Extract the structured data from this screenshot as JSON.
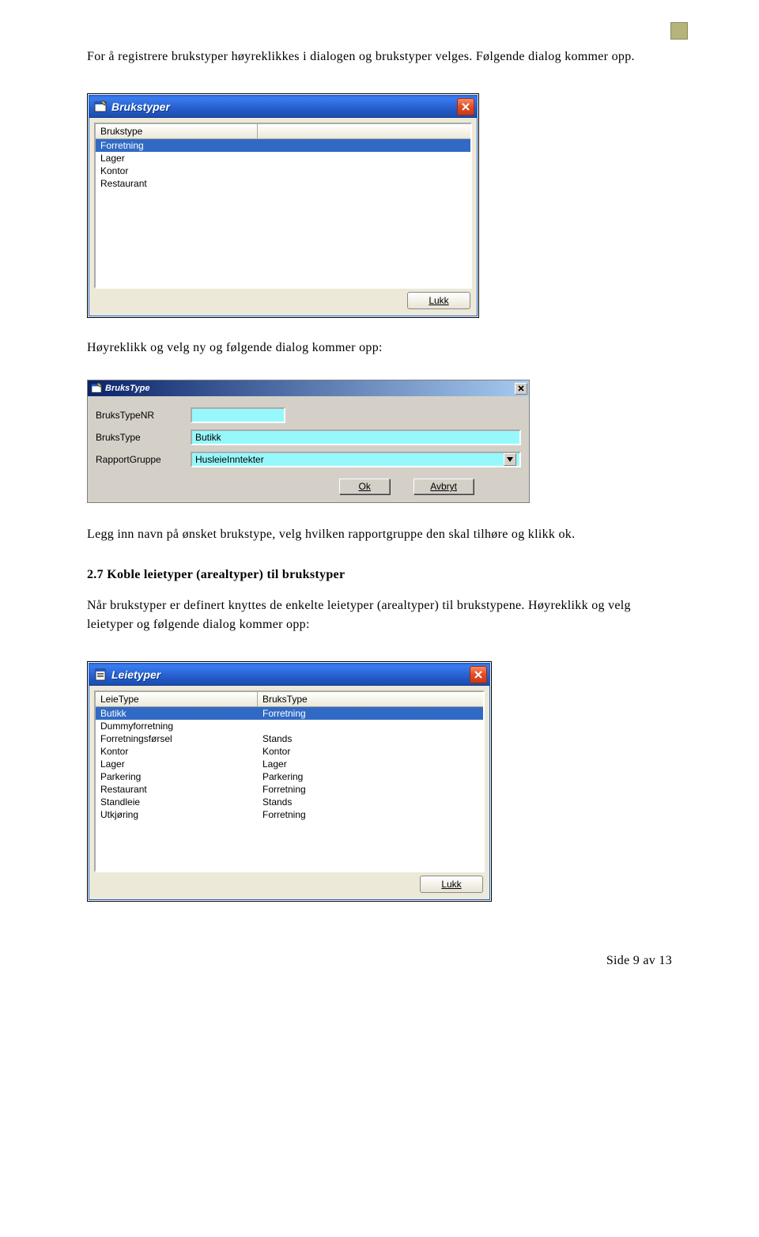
{
  "para1": "For å registrere brukstyper høyreklikkes i dialogen og brukstyper velges. Følgende dialog kommer opp.",
  "para2": "Høyreklikk og velg ny og følgende dialog kommer opp:",
  "para3": "Legg inn navn på ønsket brukstype, velg hvilken rapportgruppe den skal tilhøre og klikk ok.",
  "sectionHeading": "2.7 Koble leietyper (arealtyper) til brukstyper",
  "para4": "Når brukstyper er definert knyttes de enkelte leietyper (arealtyper) til brukstypene. Høyreklikk og velg leietyper og følgende dialog kommer opp:",
  "pageFooter": "Side 9 av 13",
  "dlg1": {
    "title": "Brukstyper",
    "header": "Brukstype",
    "items": [
      "Forretning",
      "Lager",
      "Kontor",
      "Restaurant"
    ],
    "selectedIndex": 0,
    "closeBtn": "Lukk"
  },
  "dlg2": {
    "title": "BruksType",
    "labels": {
      "nr": "BruksTypeNR",
      "type": "BruksType",
      "grp": "RapportGruppe"
    },
    "values": {
      "nr": "",
      "type": "Butikk",
      "grp": "HusleieInntekter"
    },
    "okBtn": "Ok",
    "cancelBtn": "Avbryt"
  },
  "dlg3": {
    "title": "Leietyper",
    "headers": {
      "a": "LeieType",
      "b": "BruksType"
    },
    "rows": [
      {
        "a": "Butikk",
        "b": "Forretning"
      },
      {
        "a": "Dummyforretning",
        "b": ""
      },
      {
        "a": "Forretningsførsel",
        "b": "Stands"
      },
      {
        "a": "Kontor",
        "b": "Kontor"
      },
      {
        "a": "Lager",
        "b": "Lager"
      },
      {
        "a": "Parkering",
        "b": "Parkering"
      },
      {
        "a": "Restaurant",
        "b": "Forretning"
      },
      {
        "a": "Standleie",
        "b": "Stands"
      },
      {
        "a": "Utkjøring",
        "b": "Forretning"
      }
    ],
    "selectedIndex": 0,
    "closeBtn": "Lukk"
  }
}
